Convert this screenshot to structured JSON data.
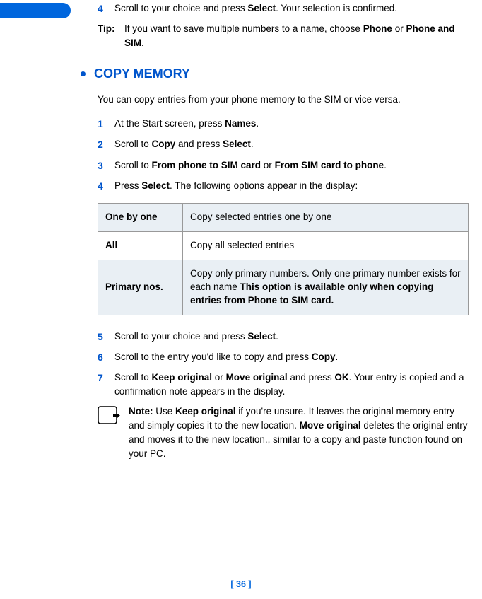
{
  "step4": {
    "num": "4",
    "text_a": "Scroll to your choice and press ",
    "text_b": "Select",
    "text_c": ". Your selection is confirmed."
  },
  "tip": {
    "label": "Tip:",
    "text_a": "If you want to save multiple numbers to a name, choose ",
    "text_b": "Phone",
    "text_c": " or ",
    "text_d": "Phone and SIM",
    "text_e": "."
  },
  "section_title": "COPY MEMORY",
  "intro": "You can copy entries from your phone memory to the SIM or vice versa.",
  "steps": {
    "s1": {
      "num": "1",
      "a": "At the Start screen, press ",
      "b": "Names",
      "c": "."
    },
    "s2": {
      "num": "2",
      "a": "Scroll to ",
      "b": "Copy",
      "c": " and press ",
      "d": "Select",
      "e": "."
    },
    "s3": {
      "num": "3",
      "a": "Scroll to ",
      "b": "From phone to SIM card",
      "c": " or ",
      "d": "From SIM card to phone",
      "e": "."
    },
    "s4": {
      "num": "4",
      "a": "Press ",
      "b": "Select",
      "c": ". The following options appear in the display:"
    },
    "s5": {
      "num": "5",
      "a": "Scroll to your choice and press ",
      "b": "Select",
      "c": "."
    },
    "s6": {
      "num": "6",
      "a": "Scroll to the entry you'd like to copy and press ",
      "b": "Copy",
      "c": "."
    },
    "s7": {
      "num": "7",
      "a": "Scroll to ",
      "b": "Keep original",
      "c": " or ",
      "d": "Move original",
      "e": " and press ",
      "f": "OK",
      "g": ". Your entry is copied and a confirmation note appears in the display."
    }
  },
  "table": {
    "r1": {
      "left": "One by one",
      "right": "Copy selected entries one by one"
    },
    "r2": {
      "left": "All",
      "right": "Copy all selected entries"
    },
    "r3": {
      "left": "Primary nos.",
      "right_a": "Copy only primary numbers. Only one primary number exists for each name ",
      "right_b": "This option is available only when copying entries from Phone to SIM card."
    }
  },
  "note": {
    "a": "Note:",
    "b": " Use ",
    "c": "Keep original",
    "d": " if you're unsure. It leaves the original memory entry and simply copies it to the new location. ",
    "e": "Move original",
    "f": " deletes the original entry and moves it to the new location., similar to a copy and paste function found on your PC."
  },
  "page_number": "[ 36 ]"
}
